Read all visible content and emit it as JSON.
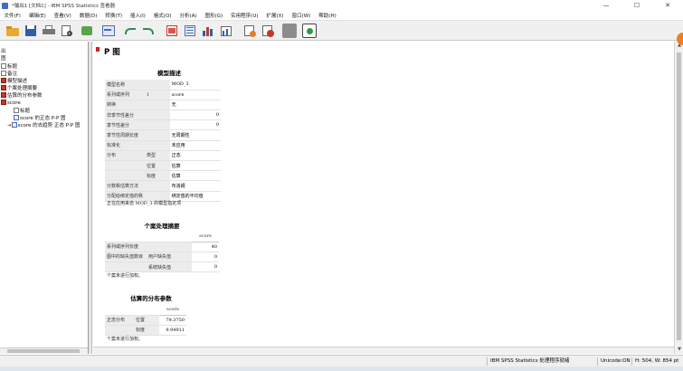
{
  "window": {
    "title": "*输出1 [文档1] - IBM SPSS Statistics 查看器",
    "controls": [
      "—",
      "☐",
      "✕"
    ]
  },
  "menu": [
    "文件(F)",
    "编辑(E)",
    "查看(V)",
    "数据(D)",
    "转换(T)",
    "插入(I)",
    "格式(O)",
    "分析(A)",
    "图形(G)",
    "实用程序(U)",
    "扩展(X)",
    "窗口(W)",
    "帮助(H)"
  ],
  "outline": {
    "items": [
      {
        "label": "出"
      },
      {
        "label": "图"
      },
      {
        "label": "标题"
      },
      {
        "label": "备注"
      },
      {
        "label": "模型描述"
      },
      {
        "label": "个案处理摘要"
      },
      {
        "label": "估算的分布参数"
      },
      {
        "label": "score"
      },
      {
        "label": "标题"
      },
      {
        "label": "score 的正态 P-P 图"
      },
      {
        "label": "score 的去趋势 正态 P-P 图"
      }
    ]
  },
  "content": {
    "section_title": "P 图",
    "model_desc": {
      "title": "模型描述",
      "rows": [
        [
          "模型名称",
          "",
          "MOD_3",
          ""
        ],
        [
          "系列或序列",
          "1",
          "score",
          ""
        ],
        [
          "转换",
          "",
          "无",
          ""
        ],
        [
          "非季节性差分",
          "",
          "",
          "0"
        ],
        [
          "季节性差分",
          "",
          "",
          "0"
        ],
        [
          "季节性周期长度",
          "",
          "无周期性",
          ""
        ],
        [
          "标准化",
          "",
          "未应用",
          ""
        ],
        [
          "分布",
          "类型",
          "正态",
          ""
        ],
        [
          "",
          "位置",
          "估算",
          ""
        ],
        [
          "",
          "标度",
          "估算",
          ""
        ],
        [
          "分数秩估算方法",
          "",
          "布洛姆",
          ""
        ],
        [
          "分配给绑定值的秩",
          "",
          "绑定值的平均值",
          ""
        ]
      ],
      "note": "正在应用来自 MOD_3 的模型指定项"
    },
    "case_summary": {
      "title": "个案处理摘要",
      "col_header": "score",
      "rows": [
        [
          "系列或序列长度",
          "",
          "40"
        ],
        [
          "图中的缺失值数目",
          "用户缺失值",
          "0"
        ],
        [
          "",
          "系统缺失值",
          "0"
        ]
      ],
      "note": "个案未进行加权。"
    },
    "est_params": {
      "title": "估算的分布参数",
      "col_header": "score",
      "rows": [
        [
          "正态分布",
          "位置",
          "79.3750"
        ],
        [
          "",
          "标度",
          "9.94911"
        ]
      ],
      "note": "个案未进行加权。"
    }
  },
  "status": {
    "processor": "IBM SPSS Statistics 处理程序就绪",
    "unicode": "Unicode:ON",
    "dims": "H: 504, W: 854 pt"
  }
}
